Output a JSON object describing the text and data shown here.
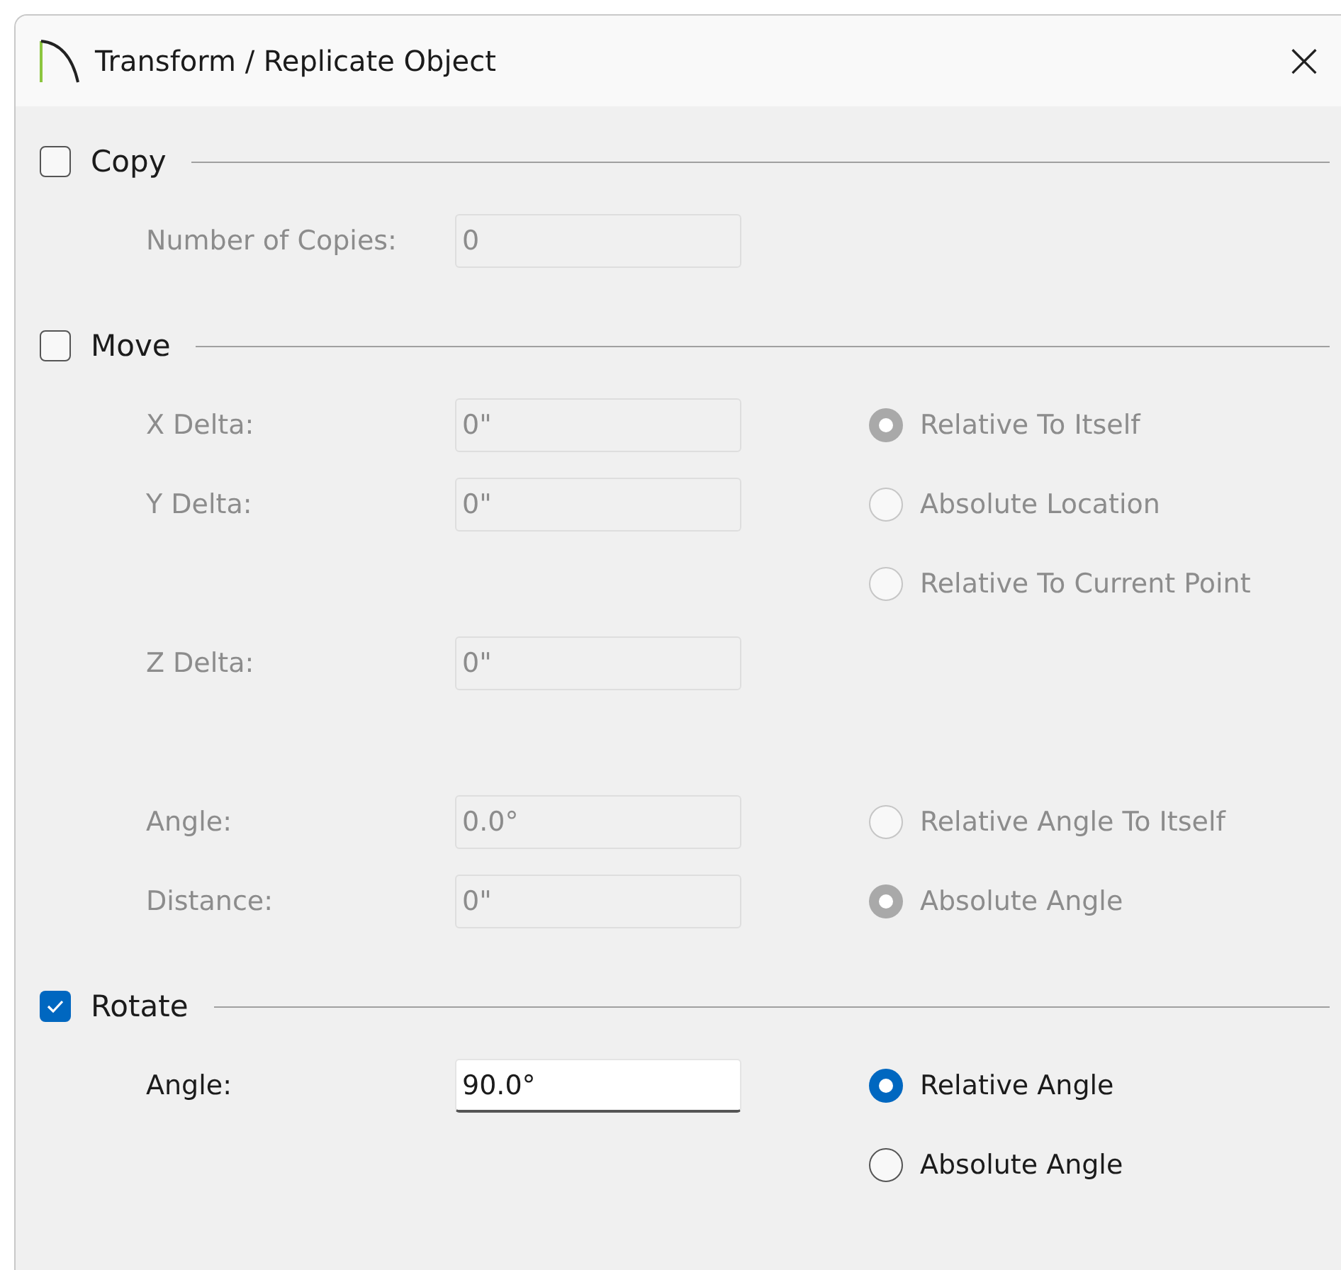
{
  "window": {
    "title": "Transform / Replicate Object",
    "close": "×"
  },
  "sections": [
    {
      "label": "Copy",
      "checked": false,
      "groups": [
        [
          {
            "label": "Number of Copies:",
            "value": "0"
          }
        ]
      ]
    },
    {
      "label": "Move",
      "checked": false,
      "groups": [
        [
          {
            "label": "X Delta:",
            "value": "0\"",
            "option": {
              "label": "Relative To Itself",
              "selected": true
            }
          },
          {
            "label": "Y Delta:",
            "value": "0\"",
            "option": {
              "label": "Absolute Location",
              "selected": false
            }
          },
          {
            "option": {
              "label": "Relative To Current Point",
              "selected": false
            }
          },
          {
            "label": "Z Delta:",
            "value": "0\""
          }
        ],
        [
          {
            "label": "Angle:",
            "value": "0.0°",
            "option": {
              "label": "Relative Angle To Itself",
              "selected": false
            }
          },
          {
            "label": "Distance:",
            "value": "0\"",
            "option": {
              "label": "Absolute Angle",
              "selected": true
            }
          }
        ]
      ]
    },
    {
      "label": "Rotate",
      "checked": true,
      "groups": [
        [
          {
            "label": "Angle:",
            "value": "90.0°",
            "option": {
              "label": "Relative Angle",
              "selected": true
            }
          },
          {
            "option": {
              "label": "Absolute Angle",
              "selected": false
            }
          }
        ]
      ]
    }
  ]
}
